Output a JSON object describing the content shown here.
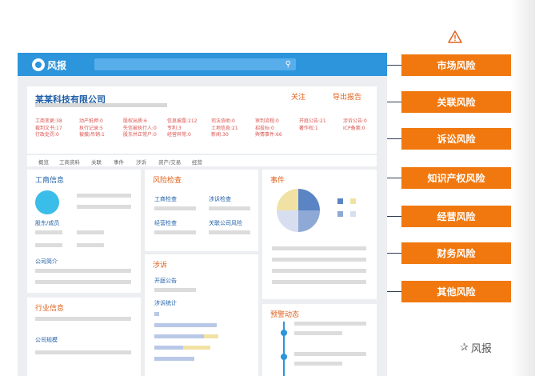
{
  "app": {
    "logo_text": "风报",
    "search_placeholder": ""
  },
  "company": {
    "name": "某某科技有限公司",
    "follow": "关注",
    "export": "导出报告",
    "stats_rows": [
      [
        "工商变更:38",
        "动产抵押:0",
        "股权出质:6",
        "信息披露:212",
        "司法协助:0",
        "审判流程:0",
        "开庭公告:21",
        "涉诉公告:0"
      ],
      [
        "裁判文书:17",
        "执行记录:5",
        "失信被执行人:0",
        "专利:3",
        "土地信息:21",
        "招投标:0",
        "著作权:1",
        "ICP备案:0"
      ],
      [
        "行政处罚:0",
        "被撤/吊销:1",
        "股东并正常户:0",
        "经营异常:0",
        "新闻:30",
        "舆情事件:66",
        "",
        ""
      ]
    ]
  },
  "tabs": [
    "概览",
    "工商资料",
    "关联",
    "事件",
    "涉诉",
    "资产/交易",
    "经营"
  ],
  "gongshang": {
    "title": "工商信息",
    "shareholders": "股东/成员",
    "intro": "公司简介"
  },
  "risk": {
    "title": "风险检查",
    "items": [
      "工商检查",
      "涉诉检查",
      "经营检查",
      "关联公司风险"
    ]
  },
  "event": {
    "title": "事件"
  },
  "litigation": {
    "title": "涉诉",
    "hearing": "开庭公告",
    "stats": "涉诉统计"
  },
  "industry": {
    "title": "行业信息",
    "scale": "公司规模"
  },
  "alert": {
    "title": "预警动态"
  },
  "risk_tags": [
    "市场风险",
    "关联风险",
    "诉讼风险",
    "知识产权风险",
    "经营风险",
    "财务风险",
    "其他风险"
  ],
  "watermark": {
    "icon": "wechat-icon",
    "text": "风报"
  },
  "icons": {
    "warning": "warning-triangle-icon",
    "search": "search-icon"
  },
  "colors": {
    "accent": "#2c95dc",
    "tag": "#f0780f",
    "title_blue": "#1f5fa8",
    "title_orange": "#e0621c",
    "stat_red": "#d9534f"
  }
}
